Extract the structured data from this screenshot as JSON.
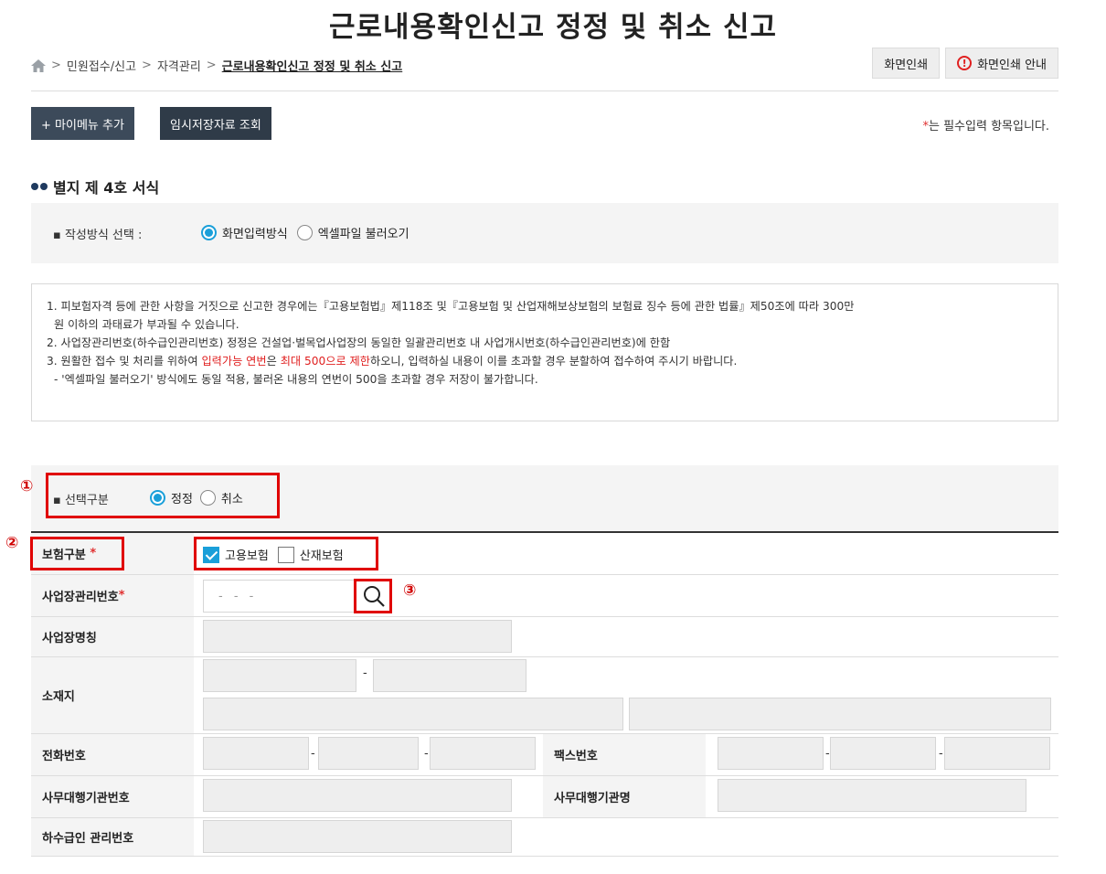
{
  "page": {
    "title": "근로내용확인신고 정정 및 취소 신고"
  },
  "breadcrumb": {
    "items": [
      "민원접수/신고",
      "자격관리"
    ],
    "current": "근로내용확인신고 정정 및 취소 신고"
  },
  "top_buttons": {
    "print": "화면인쇄",
    "print_guide": "화면인쇄 안내"
  },
  "toolbar": {
    "mymenu": "+ 마이메뉴 추가",
    "temp_saved": "임시저장자료 조회",
    "required_note": "는 필수입력 항목입니다.",
    "required_star": "*"
  },
  "section": {
    "title": "별지 제 4호 서식"
  },
  "method": {
    "label": "▪ 작성방식 선택 :",
    "option_screen": "화면입력방식",
    "option_excel": "엑셀파일 불러오기",
    "selected": "화면입력방식"
  },
  "notice": {
    "line1a": "1. 피보험자격 등에 관한 사항을 거짓으로 신고한 경우에는『고용보험법』제118조 및『고용보험 및 산업재해보상보험의 보험료 징수 등에 관한 법률』제50조에 따라 300만",
    "line1b": "원 이하의 과태료가 부과될 수 있습니다.",
    "line2": "2. 사업장관리번호(하수급인관리번호) 정정은 건설업·벌목업사업장의 동일한 일괄관리번호 내 사업개시번호(하수급인관리번호)에 한함",
    "line3_pre": "3. 원활한 접수 및 처리를 위하여 ",
    "line3_red1": "입력가능 연번",
    "line3_mid": "은 ",
    "line3_red2": "최대 500으로 제한",
    "line3_post": "하오니, 입력하실 내용이 이를 초과할 경우 분할하여 접수하여 주시기 바랍니다.",
    "line4": "- '엑셀파일 불러오기' 방식에도 동일 적용, 불러온 내용의 연번이 500을 초과할 경우 저장이 불가합니다."
  },
  "selection": {
    "label": "▪ 선택구분",
    "option_correct": "정정",
    "option_cancel": "취소",
    "selected": "정정"
  },
  "callouts": {
    "n1": "①",
    "n2": "②",
    "n3": "③"
  },
  "form": {
    "insurance_label": "보험구분",
    "insurance_employment": "고용보험",
    "insurance_industrial": "산재보험",
    "biz_no_label": "사업장관리번호",
    "biz_no_placeholder": "- - -",
    "biz_name_label": "사업장명칭",
    "address_label": "소재지",
    "address_dash": "-",
    "phone_label": "전화번호",
    "fax_label": "팩스번호",
    "phone_dash": "-",
    "agency_no_label": "사무대행기관번호",
    "agency_name_label": "사무대행기관명",
    "sub_no_label": "하수급인 관리번호",
    "required_star": "*"
  },
  "colors": {
    "accent_blue": "#1a9fd9",
    "dark_button": "#3c4a5a",
    "callout_red": "#e00000"
  }
}
